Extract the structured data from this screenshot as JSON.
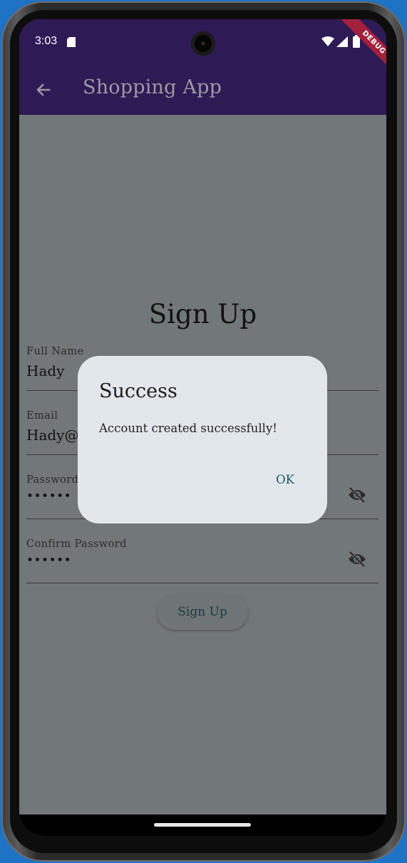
{
  "status_bar": {
    "time": "3:03"
  },
  "debug_banner": "DEBUG",
  "app_bar": {
    "title": "Shopping App"
  },
  "form": {
    "title": "Sign Up",
    "full_name": {
      "label": "Full Name",
      "value": "Hady"
    },
    "email": {
      "label": "Email",
      "value": "Hady@"
    },
    "password": {
      "label": "Password",
      "value": "••••••"
    },
    "confirm_password": {
      "label": "Confirm Password",
      "value": "••••••"
    },
    "submit_label": "Sign Up"
  },
  "dialog": {
    "title": "Success",
    "message": "Account created successfully!",
    "ok_label": "OK"
  },
  "colors": {
    "app_bar": "#2e1a54",
    "scrim_background": "#727779",
    "dialog_background": "#e1e7ea",
    "accent_text": "#1f5a63"
  }
}
